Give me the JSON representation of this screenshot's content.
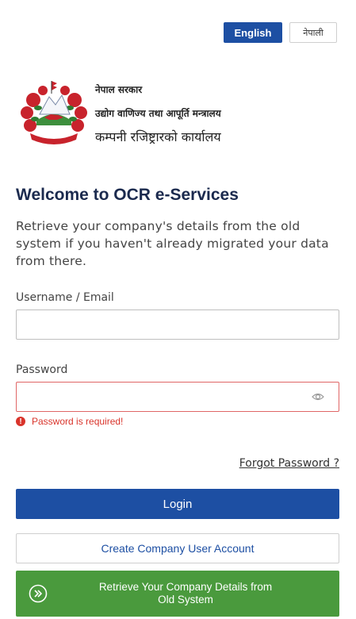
{
  "language": {
    "english_label": "English",
    "nepali_label": "नेपाली",
    "active": "English"
  },
  "header": {
    "org_line_1": "नेपाल सरकार",
    "org_line_2": "उद्योग वाणिज्य तथा आपूर्ति मन्त्रालय",
    "org_line_3": "कम्पनी रजिष्ट्रारको कार्यालय"
  },
  "main": {
    "title": "Welcome to OCR e-Services",
    "description": "Retrieve your company's details from the old system if you haven't already migrated your data from there."
  },
  "form": {
    "username_label": "Username / Email",
    "username_value": "",
    "password_label": "Password",
    "password_value": "",
    "password_error": "Password is required!",
    "forgot_password": "Forgot Password ?"
  },
  "actions": {
    "login": "Login",
    "create_account": "Create Company User Account",
    "retrieve_line_1": "Retrieve Your Company Details from",
    "retrieve_line_2": "Old System"
  },
  "colors": {
    "primary": "#1d4fa3",
    "success": "#4a9a3d",
    "error": "#d9342b"
  }
}
